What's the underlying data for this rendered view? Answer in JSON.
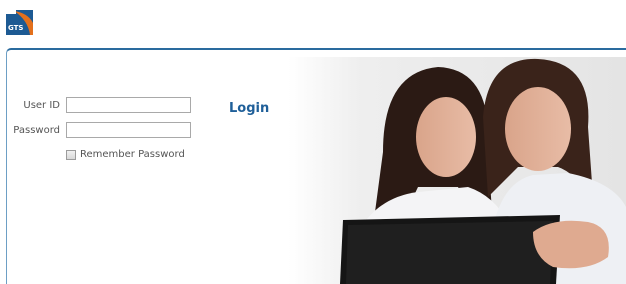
{
  "logo": {
    "text": "GTS"
  },
  "form": {
    "user_id_label": "User ID",
    "user_id_value": "",
    "password_label": "Password",
    "password_value": "",
    "remember_label": "Remember Password",
    "login_label": "Login"
  },
  "colors": {
    "accent": "#1f5f99",
    "logo_orange": "#e3701c",
    "logo_blue": "#1d5a93"
  }
}
